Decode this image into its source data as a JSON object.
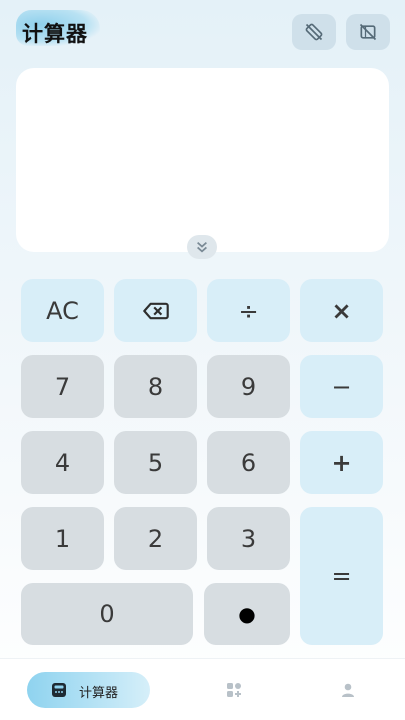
{
  "header": {
    "title": "计算器",
    "rotate_icon": "screen-rotation-icon",
    "no_rotate_icon": "screen-lock-rotation-icon"
  },
  "display": {
    "expression": "",
    "collapse_icon": "double-chevron-down-icon"
  },
  "keys": {
    "ac": "AC",
    "backspace_icon": "backspace-icon",
    "divide": "÷",
    "multiply": "×",
    "seven": "7",
    "eight": "8",
    "nine": "9",
    "minus": "−",
    "four": "4",
    "five": "5",
    "six": "6",
    "plus": "+",
    "one": "1",
    "two": "2",
    "three": "3",
    "equals": "=",
    "zero": "0",
    "dot": "●"
  },
  "nav": {
    "calculator_label": "计算器",
    "calculator_icon": "calculator-icon",
    "tools_icon": "apps-add-icon",
    "profile_icon": "person-icon"
  },
  "colors": {
    "accent": "#8fd3ef",
    "number_key": "#d7dde1",
    "operator_key": "#d8eef8"
  }
}
